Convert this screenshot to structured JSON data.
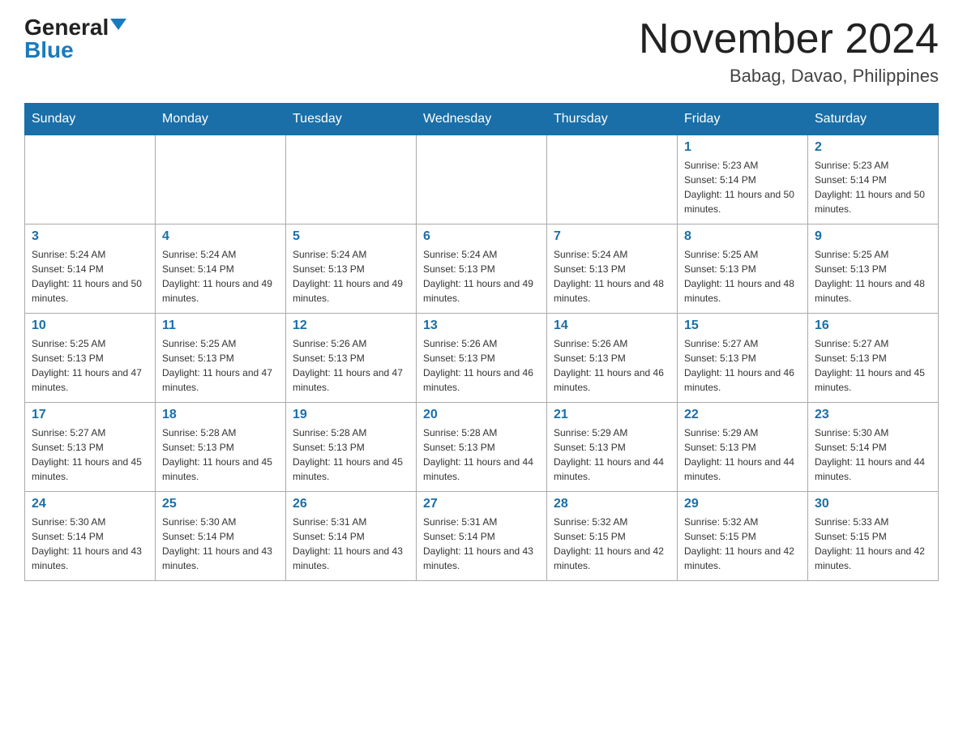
{
  "logo": {
    "general": "General",
    "blue": "Blue"
  },
  "title": "November 2024",
  "location": "Babag, Davao, Philippines",
  "days_of_week": [
    "Sunday",
    "Monday",
    "Tuesday",
    "Wednesday",
    "Thursday",
    "Friday",
    "Saturday"
  ],
  "weeks": [
    [
      {
        "day": "",
        "info": ""
      },
      {
        "day": "",
        "info": ""
      },
      {
        "day": "",
        "info": ""
      },
      {
        "day": "",
        "info": ""
      },
      {
        "day": "",
        "info": ""
      },
      {
        "day": "1",
        "info": "Sunrise: 5:23 AM\nSunset: 5:14 PM\nDaylight: 11 hours and 50 minutes."
      },
      {
        "day": "2",
        "info": "Sunrise: 5:23 AM\nSunset: 5:14 PM\nDaylight: 11 hours and 50 minutes."
      }
    ],
    [
      {
        "day": "3",
        "info": "Sunrise: 5:24 AM\nSunset: 5:14 PM\nDaylight: 11 hours and 50 minutes."
      },
      {
        "day": "4",
        "info": "Sunrise: 5:24 AM\nSunset: 5:14 PM\nDaylight: 11 hours and 49 minutes."
      },
      {
        "day": "5",
        "info": "Sunrise: 5:24 AM\nSunset: 5:13 PM\nDaylight: 11 hours and 49 minutes."
      },
      {
        "day": "6",
        "info": "Sunrise: 5:24 AM\nSunset: 5:13 PM\nDaylight: 11 hours and 49 minutes."
      },
      {
        "day": "7",
        "info": "Sunrise: 5:24 AM\nSunset: 5:13 PM\nDaylight: 11 hours and 48 minutes."
      },
      {
        "day": "8",
        "info": "Sunrise: 5:25 AM\nSunset: 5:13 PM\nDaylight: 11 hours and 48 minutes."
      },
      {
        "day": "9",
        "info": "Sunrise: 5:25 AM\nSunset: 5:13 PM\nDaylight: 11 hours and 48 minutes."
      }
    ],
    [
      {
        "day": "10",
        "info": "Sunrise: 5:25 AM\nSunset: 5:13 PM\nDaylight: 11 hours and 47 minutes."
      },
      {
        "day": "11",
        "info": "Sunrise: 5:25 AM\nSunset: 5:13 PM\nDaylight: 11 hours and 47 minutes."
      },
      {
        "day": "12",
        "info": "Sunrise: 5:26 AM\nSunset: 5:13 PM\nDaylight: 11 hours and 47 minutes."
      },
      {
        "day": "13",
        "info": "Sunrise: 5:26 AM\nSunset: 5:13 PM\nDaylight: 11 hours and 46 minutes."
      },
      {
        "day": "14",
        "info": "Sunrise: 5:26 AM\nSunset: 5:13 PM\nDaylight: 11 hours and 46 minutes."
      },
      {
        "day": "15",
        "info": "Sunrise: 5:27 AM\nSunset: 5:13 PM\nDaylight: 11 hours and 46 minutes."
      },
      {
        "day": "16",
        "info": "Sunrise: 5:27 AM\nSunset: 5:13 PM\nDaylight: 11 hours and 45 minutes."
      }
    ],
    [
      {
        "day": "17",
        "info": "Sunrise: 5:27 AM\nSunset: 5:13 PM\nDaylight: 11 hours and 45 minutes."
      },
      {
        "day": "18",
        "info": "Sunrise: 5:28 AM\nSunset: 5:13 PM\nDaylight: 11 hours and 45 minutes."
      },
      {
        "day": "19",
        "info": "Sunrise: 5:28 AM\nSunset: 5:13 PM\nDaylight: 11 hours and 45 minutes."
      },
      {
        "day": "20",
        "info": "Sunrise: 5:28 AM\nSunset: 5:13 PM\nDaylight: 11 hours and 44 minutes."
      },
      {
        "day": "21",
        "info": "Sunrise: 5:29 AM\nSunset: 5:13 PM\nDaylight: 11 hours and 44 minutes."
      },
      {
        "day": "22",
        "info": "Sunrise: 5:29 AM\nSunset: 5:13 PM\nDaylight: 11 hours and 44 minutes."
      },
      {
        "day": "23",
        "info": "Sunrise: 5:30 AM\nSunset: 5:14 PM\nDaylight: 11 hours and 44 minutes."
      }
    ],
    [
      {
        "day": "24",
        "info": "Sunrise: 5:30 AM\nSunset: 5:14 PM\nDaylight: 11 hours and 43 minutes."
      },
      {
        "day": "25",
        "info": "Sunrise: 5:30 AM\nSunset: 5:14 PM\nDaylight: 11 hours and 43 minutes."
      },
      {
        "day": "26",
        "info": "Sunrise: 5:31 AM\nSunset: 5:14 PM\nDaylight: 11 hours and 43 minutes."
      },
      {
        "day": "27",
        "info": "Sunrise: 5:31 AM\nSunset: 5:14 PM\nDaylight: 11 hours and 43 minutes."
      },
      {
        "day": "28",
        "info": "Sunrise: 5:32 AM\nSunset: 5:15 PM\nDaylight: 11 hours and 42 minutes."
      },
      {
        "day": "29",
        "info": "Sunrise: 5:32 AM\nSunset: 5:15 PM\nDaylight: 11 hours and 42 minutes."
      },
      {
        "day": "30",
        "info": "Sunrise: 5:33 AM\nSunset: 5:15 PM\nDaylight: 11 hours and 42 minutes."
      }
    ]
  ]
}
